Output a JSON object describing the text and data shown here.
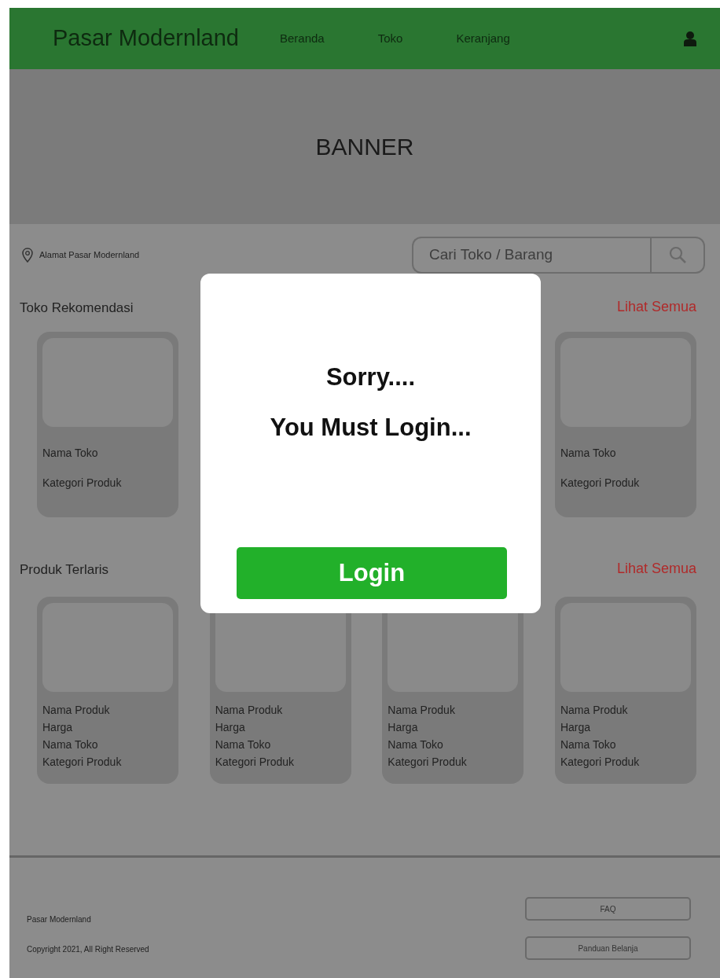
{
  "navbar": {
    "brand": "Pasar Modernland",
    "links": [
      {
        "label": "Beranda"
      },
      {
        "label": "Toko"
      },
      {
        "label": "Keranjang"
      }
    ]
  },
  "banner": {
    "text": "BANNER"
  },
  "address": "Alamat Pasar Modernland",
  "search": {
    "placeholder": "Cari Toko / Barang"
  },
  "sections": [
    {
      "title": "Toko Rekomendasi",
      "link": "Lihat Semua",
      "kind": "store",
      "cards": [
        {
          "lines": [
            "Nama Toko",
            "Kategori Produk"
          ]
        },
        {
          "lines": [
            "Nama Toko",
            "Kategori Produk"
          ]
        }
      ]
    },
    {
      "title": "Produk Terlaris",
      "link": "Lihat Semua",
      "kind": "product",
      "cards": [
        {
          "lines": [
            "Nama Produk",
            "Harga",
            "Nama Toko",
            "Kategori Produk"
          ]
        },
        {
          "lines": [
            "Nama Produk",
            "Harga",
            "Nama Toko",
            "Kategori Produk"
          ]
        },
        {
          "lines": [
            "Nama Produk",
            "Harga",
            "Nama Toko",
            "Kategori Produk"
          ]
        },
        {
          "lines": [
            "Nama Produk",
            "Harga",
            "Nama Toko",
            "Kategori Produk"
          ]
        }
      ]
    }
  ],
  "footer": {
    "lines": [
      "Pasar Modernland",
      "Copyright 2021, All Right Reserved"
    ],
    "buttons": [
      "FAQ",
      "Panduan Belanja"
    ]
  },
  "modal": {
    "lines": [
      "Sorry....",
      "You Must Login..."
    ],
    "button": "Login"
  }
}
